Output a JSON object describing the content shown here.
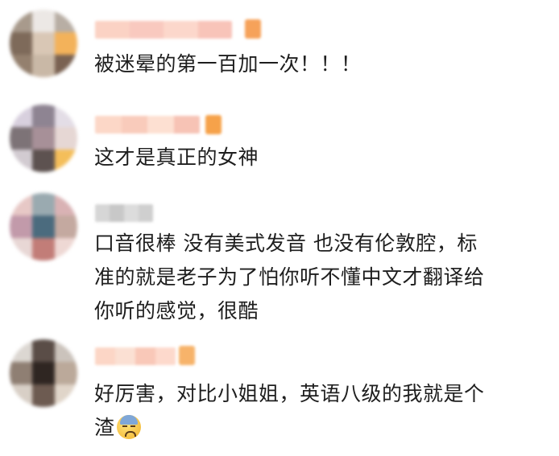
{
  "comments": [
    {
      "id": "c1",
      "avatar_colors": [
        "#a89a8c",
        "#ece8e5",
        "#b8aea4",
        "#7e6a5a",
        "#d9c7b5",
        "#f3b25a",
        "#94806e",
        "#c9b8a6",
        "#7a6252"
      ],
      "name_bar_colors": [
        "#fbd2c4",
        "#f9c9bf",
        "#fcd7cb",
        "#f8c4b9"
      ],
      "badge_color": "#f6a25a",
      "lines": [
        "被迷晕的第一百加一次！！！"
      ]
    },
    {
      "id": "c2",
      "avatar_colors": [
        "#d8d0de",
        "#8e8492",
        "#e3dde6",
        "#7d7377",
        "#a79098",
        "#e6d7d4",
        "#d2cbd1",
        "#5d5250",
        "#f4be5a"
      ],
      "name_bar_colors": [
        "#fcd7c7",
        "#f9cbbb",
        "#fde0d2",
        "#f7c3b5"
      ],
      "badge_color": "#f6a24a",
      "lines": [
        "这才是真正的女神"
      ]
    },
    {
      "id": "c3",
      "avatar_colors": [
        "#e7c8c6",
        "#9aaab0",
        "#d9b2b4",
        "#c29aaa",
        "#4b6b7e",
        "#c4a9a0",
        "#e8d7d5",
        "#c27d78",
        "#eed8d4"
      ],
      "name_bar_colors": [
        "#d6d6d6",
        "#c8c8c8",
        "#dcdcdc",
        "#cfcfcf"
      ],
      "badge_color": "",
      "lines": [
        "口音很棒 没有美式发音 也没有伦敦腔，标",
        "准的就是老子为了怕你听不懂中文才翻译给",
        "你听的感觉，很酷"
      ]
    },
    {
      "id": "c4",
      "avatar_colors": [
        "#dcd7d2",
        "#5a4d47",
        "#cbc3bc",
        "#8f7f73",
        "#2f2622",
        "#bba99a",
        "#d8cfc6",
        "#6d5b51",
        "#e0d5c9"
      ],
      "name_bar_colors": [
        "#fcd6c6",
        "#fbe0d3",
        "#f9c8b8",
        "#fdd9cc"
      ],
      "badge_color": "#f7b36a",
      "lines": [
        "好厉害，对比小姐姐，英语八级的我就是个",
        "渣"
      ],
      "emoji": "cold-sweat-emoji"
    }
  ]
}
